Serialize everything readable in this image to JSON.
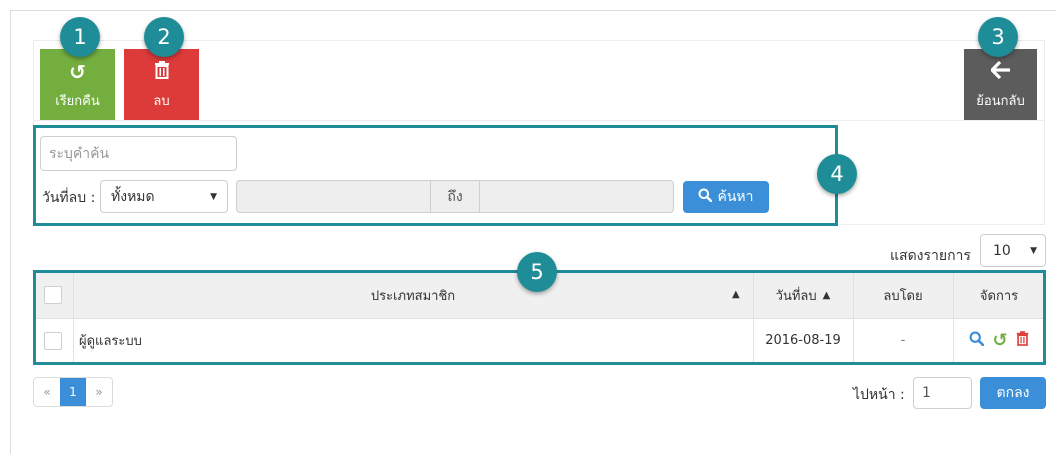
{
  "toolbar": {
    "restore_label": "เรียกคืน",
    "delete_label": "ลบ",
    "back_label": "ย้อนกลับ"
  },
  "badges": [
    "1",
    "2",
    "3",
    "4",
    "5"
  ],
  "filter": {
    "keyword_placeholder": "ระบุคำค้น",
    "date_label": "วันที่ลบ :",
    "date_select_value": "ทั้งหมด",
    "range_to_label": "ถึง",
    "search_label": "ค้นหา"
  },
  "list_controls": {
    "per_page_label": "แสดงรายการ",
    "per_page_value": "10"
  },
  "table": {
    "headers": [
      "ประเภทสมาชิก",
      "วันที่ลบ",
      "ลบโดย",
      "จัดการ"
    ],
    "rows": [
      {
        "name": "ผู้ดูแลระบบ",
        "deleted_date": "2016-08-19",
        "deleted_by": "-"
      }
    ]
  },
  "pagination": {
    "prev": "«",
    "current": "1",
    "next": "»",
    "goto_label": "ไปหน้า :",
    "goto_value": "1",
    "ok_label": "ตกลง"
  },
  "colors": {
    "restore": "#73ae3f",
    "delete": "#dd3a3a",
    "back": "#5c5c5c",
    "primary": "#3a8fd8",
    "highlight": "#1f8d98"
  },
  "icons": [
    "restore-icon",
    "trash-icon",
    "arrow-left-icon",
    "search-icon",
    "sort-up-icon"
  ]
}
